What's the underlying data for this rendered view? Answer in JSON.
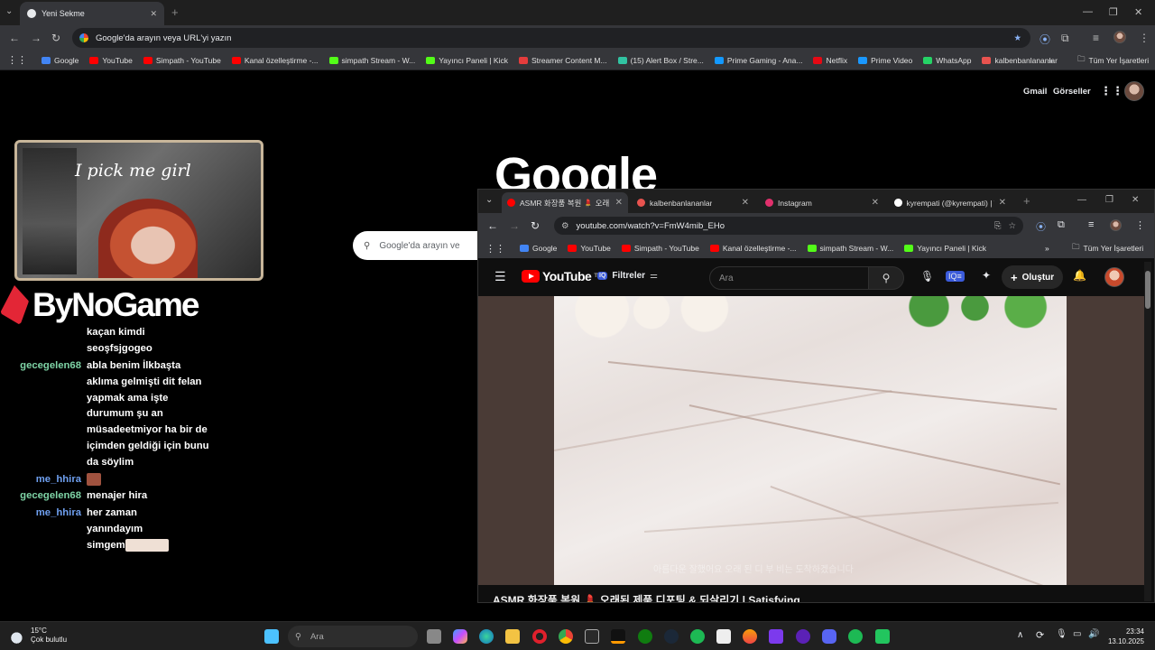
{
  "outer_browser": {
    "active_tab": "Yeni Sekme",
    "omnibox_placeholder": "Google'da arayın veya URL'yi yazın",
    "bookmarks": [
      {
        "label": "Google",
        "color": "#4285f4"
      },
      {
        "label": "YouTube",
        "color": "#ff0000"
      },
      {
        "label": "Simpath - YouTube",
        "color": "#ff0000"
      },
      {
        "label": "Kanal özelleştirme -...",
        "color": "#ff0000"
      },
      {
        "label": "simpath Stream - W...",
        "color": "#53fc18"
      },
      {
        "label": "Yayıncı Paneli | Kick",
        "color": "#53fc18"
      },
      {
        "label": "Streamer Content M...",
        "color": "#e43c3c"
      },
      {
        "label": "(15) Alert Box / Stre...",
        "color": "#31c3a2"
      },
      {
        "label": "Prime Gaming - Ana...",
        "color": "#1399ff"
      },
      {
        "label": "Netflix",
        "color": "#e50914"
      },
      {
        "label": "Prime Video",
        "color": "#1a98ff"
      },
      {
        "label": "WhatsApp",
        "color": "#25d366"
      },
      {
        "label": "kalbenbanlananlar",
        "color": "#e8534f"
      }
    ],
    "all_bookmarks": "Tüm Yer İşaretleri"
  },
  "google_page": {
    "gmail": "Gmail",
    "images": "Görseller",
    "logo": "Google",
    "search_placeholder": "Google'da arayın ve"
  },
  "overlay": {
    "cam_text": "I pick me girl",
    "sponsor": "ByNoGame",
    "chat": [
      {
        "name": "",
        "message": "kaçan kimdi",
        "color": "#ffffff"
      },
      {
        "name": "",
        "message": "seoşfsjgogeo",
        "color": "#ffffff"
      },
      {
        "name": "gecegelen68",
        "message": "abla benim İlkbaşta aklıma gelmişti dit felan yapmak ama işte durumum şu an müsadeetmiyor ha bir de içimden geldiği için bunu da söylim",
        "color": "#7ed4a6"
      },
      {
        "name": "me_hhira",
        "message": "",
        "color": "#6fa0f0"
      },
      {
        "name": "gecegelen68",
        "message": "menajer hira",
        "color": "#7ed4a6"
      },
      {
        "name": "me_hhira",
        "message": "her zaman yanındayım simgem",
        "color": "#6fa0f0"
      }
    ]
  },
  "inner_browser": {
    "tabs": [
      {
        "label": "ASMR 화장품 복원 💄 오래",
        "active": true,
        "color": "#ff0000"
      },
      {
        "label": "kalbenbanlananlar",
        "active": false,
        "color": "#e8534f"
      },
      {
        "label": "Instagram",
        "active": false,
        "color": "#e1306c"
      },
      {
        "label": "kyrempati (@kyrempati) | T",
        "active": false,
        "color": "#ffffff"
      }
    ],
    "url": "youtube.com/watch?v=FmW4mib_EHo",
    "bookmarks": [
      {
        "label": "Google",
        "color": "#4285f4"
      },
      {
        "label": "YouTube",
        "color": "#ff0000"
      },
      {
        "label": "Simpath - YouTube",
        "color": "#ff0000"
      },
      {
        "label": "Kanal özelleştirme -...",
        "color": "#ff0000"
      },
      {
        "label": "simpath Stream - W...",
        "color": "#53fc18"
      },
      {
        "label": "Yayıncı Paneli | Kick",
        "color": "#53fc18"
      }
    ],
    "all_bookmarks": "Tüm Yer İşaretleri",
    "youtube": {
      "logo": "YouTube",
      "logo_sup": "TR",
      "filters": "Filtreler",
      "search_placeholder": "Ara",
      "create": "Oluştur",
      "video_title": "ASMR 화장품 복원 💄 오래된 제품 디포팅 & 되살리기 | Satisfying",
      "subtitle": "아름다운 잘했어요 오래 된 디 부 비는 도착하겠습니다"
    }
  },
  "taskbar": {
    "temp": "15°C",
    "weather": "Çok bulutlu",
    "search": "Ara",
    "time": "23:34",
    "date": "13.10.2025"
  }
}
